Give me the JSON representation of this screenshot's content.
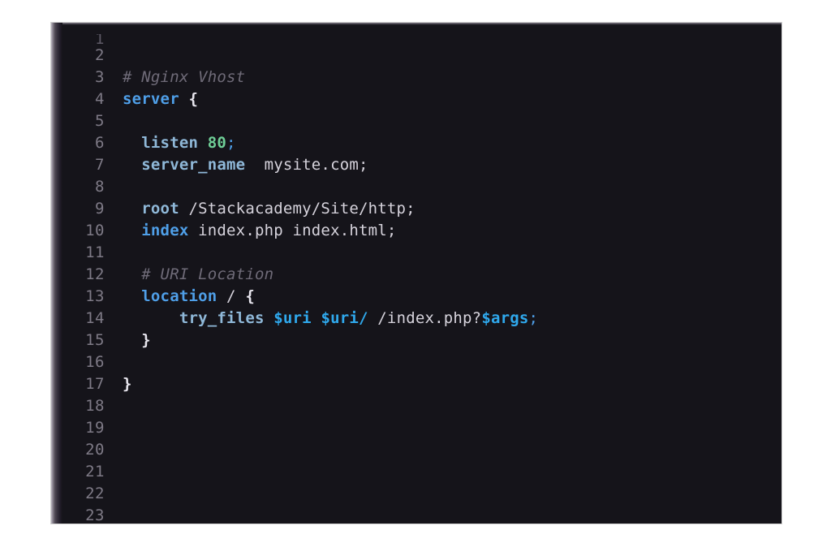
{
  "window": {
    "title": "Nginx Vhost configuration editor",
    "theme": "dark",
    "background_color": "#15141a",
    "page_background": "#ffffff",
    "gutter_color": "#7e7a86"
  },
  "colors": {
    "comment": "#6f6b78",
    "keyword": "#4f9fe8",
    "directive": "#8fb8d8",
    "number": "#6fcf97",
    "variable": "#2fa8ec",
    "text": "#d6d3dc",
    "brace": "#e8e6ee"
  },
  "editor": {
    "language": "nginx",
    "first_visible_line": 1,
    "last_visible_line": 23,
    "lines": [
      {
        "number": "1",
        "clipped": true,
        "tokens": []
      },
      {
        "number": "2",
        "tokens": []
      },
      {
        "number": "3",
        "tokens": [
          {
            "t": "# Nginx Vhost",
            "c": "tok-comment"
          }
        ]
      },
      {
        "number": "4",
        "tokens": [
          {
            "t": "server",
            "c": "tok-keyword"
          },
          {
            "t": " ",
            "c": "tok-text"
          },
          {
            "t": "{",
            "c": "tok-brace"
          }
        ]
      },
      {
        "number": "5",
        "tokens": []
      },
      {
        "number": "6",
        "tokens": [
          {
            "t": "  ",
            "c": "tok-text"
          },
          {
            "t": "listen",
            "c": "tok-directive"
          },
          {
            "t": " ",
            "c": "tok-text"
          },
          {
            "t": "80",
            "c": "tok-number"
          },
          {
            "t": ";",
            "c": "tok-punct"
          }
        ]
      },
      {
        "number": "7",
        "tokens": [
          {
            "t": "  ",
            "c": "tok-text"
          },
          {
            "t": "server_name",
            "c": "tok-directive"
          },
          {
            "t": "  ",
            "c": "tok-text"
          },
          {
            "t": "mysite.com;",
            "c": "tok-text"
          }
        ]
      },
      {
        "number": "8",
        "tokens": []
      },
      {
        "number": "9",
        "tokens": [
          {
            "t": "  ",
            "c": "tok-text"
          },
          {
            "t": "root",
            "c": "tok-directive"
          },
          {
            "t": " ",
            "c": "tok-text"
          },
          {
            "t": "/Stackacademy/Site/http;",
            "c": "tok-path"
          }
        ]
      },
      {
        "number": "10",
        "tokens": [
          {
            "t": "  ",
            "c": "tok-text"
          },
          {
            "t": "index",
            "c": "tok-keyword"
          },
          {
            "t": " ",
            "c": "tok-text"
          },
          {
            "t": "index.php index.html;",
            "c": "tok-path"
          }
        ]
      },
      {
        "number": "11",
        "tokens": []
      },
      {
        "number": "12",
        "tokens": [
          {
            "t": "  ",
            "c": "tok-text"
          },
          {
            "t": "# URI Location",
            "c": "tok-comment"
          }
        ]
      },
      {
        "number": "13",
        "tokens": [
          {
            "t": "  ",
            "c": "tok-text"
          },
          {
            "t": "location",
            "c": "tok-keyword"
          },
          {
            "t": " / ",
            "c": "tok-text"
          },
          {
            "t": "{",
            "c": "tok-brace"
          }
        ]
      },
      {
        "number": "14",
        "tokens": [
          {
            "t": "      ",
            "c": "tok-text"
          },
          {
            "t": "try_files",
            "c": "tok-directive"
          },
          {
            "t": " ",
            "c": "tok-text"
          },
          {
            "t": "$uri",
            "c": "tok-var"
          },
          {
            "t": " ",
            "c": "tok-text"
          },
          {
            "t": "$uri/",
            "c": "tok-var"
          },
          {
            "t": " /index.php?",
            "c": "tok-text"
          },
          {
            "t": "$args",
            "c": "tok-var"
          },
          {
            "t": ";",
            "c": "tok-punct"
          }
        ]
      },
      {
        "number": "15",
        "tokens": [
          {
            "t": "  ",
            "c": "tok-text"
          },
          {
            "t": "}",
            "c": "tok-brace"
          }
        ]
      },
      {
        "number": "16",
        "tokens": []
      },
      {
        "number": "17",
        "tokens": [
          {
            "t": "}",
            "c": "tok-brace"
          }
        ]
      },
      {
        "number": "18",
        "tokens": []
      },
      {
        "number": "19",
        "tokens": []
      },
      {
        "number": "20",
        "tokens": []
      },
      {
        "number": "21",
        "tokens": []
      },
      {
        "number": "22",
        "tokens": []
      },
      {
        "number": "23",
        "tokens": []
      }
    ],
    "plain_text": "# Nginx Vhost\nserver {\n\n  listen 80;\n  server_name  mysite.com;\n\n  root /Stackacademy/Site/http;\n  index index.php index.html;\n\n  # URI Location\n  location / {\n      try_files $uri $uri/ /index.php?$args;\n  }\n\n}"
  }
}
